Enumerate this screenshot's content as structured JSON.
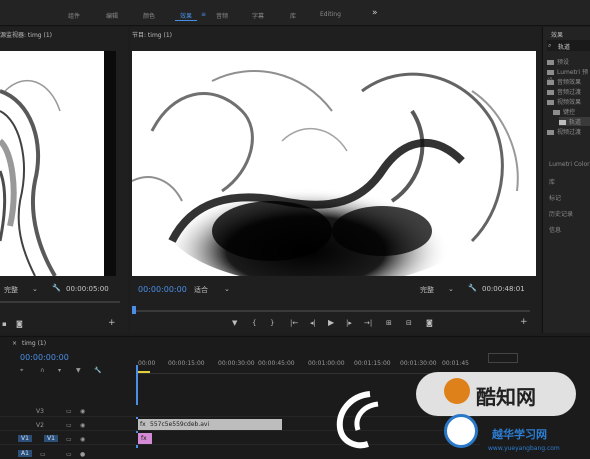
{
  "topbar": {
    "tabs": [
      {
        "label": "组件"
      },
      {
        "label": "编辑"
      },
      {
        "label": "颜色"
      },
      {
        "label": "效果"
      },
      {
        "label": "音频"
      },
      {
        "label": "字幕"
      },
      {
        "label": "库"
      },
      {
        "label": "Editing"
      }
    ],
    "active_tab": "效果",
    "more_label": "»"
  },
  "source_monitor": {
    "title": "源监视器: timg (1)",
    "fit_label": "完整",
    "timecode": "00:00:05:00"
  },
  "program_monitor": {
    "title": "节目: timg (1)",
    "current_timecode": "00:00:00:00",
    "fit_label": "适合",
    "quality_label": "完整",
    "duration_timecode": "00:00:48:01"
  },
  "effects_panel": {
    "title": "效果",
    "search_value": "轨道",
    "tree_items": [
      {
        "label": "预设"
      },
      {
        "label": "Lumetri 预设"
      },
      {
        "label": "音频效果"
      },
      {
        "label": "音频过渡"
      },
      {
        "label": "视频效果"
      },
      {
        "label": "键控"
      },
      {
        "label": "轨道"
      },
      {
        "label": "视频过渡"
      }
    ],
    "section_labels": [
      "Lumetri Color",
      "库",
      "标记",
      "历史记录",
      "信息"
    ]
  },
  "timeline": {
    "title": "timg (1)",
    "timecode": "00:00:00:00",
    "ruler_labels": [
      "00:00",
      "00:00:15:00",
      "00:00:30:00",
      "00:00:45:00",
      "00:01:00:00",
      "00:01:15:00",
      "00:01:30:00",
      "00:01:45"
    ],
    "tracks": [
      {
        "target": "",
        "name": "V3"
      },
      {
        "target": "",
        "name": "V2"
      },
      {
        "target": "V1",
        "name": "V1"
      },
      {
        "target": "A1",
        "name": "A1"
      }
    ],
    "clip_video_name": "557c5e559cdeb.avi",
    "clip_fx_label": "fx"
  },
  "watermark": {
    "brand_text": "酷知网",
    "site_text": "越华学习网",
    "url_text": "www.yueyangbang.com"
  },
  "colors": {
    "accent": "#4a8ee6",
    "video_clip": "#bdbdbd",
    "fx_clip": "#d58ad6",
    "panel_bg": "#1f1f1f"
  }
}
